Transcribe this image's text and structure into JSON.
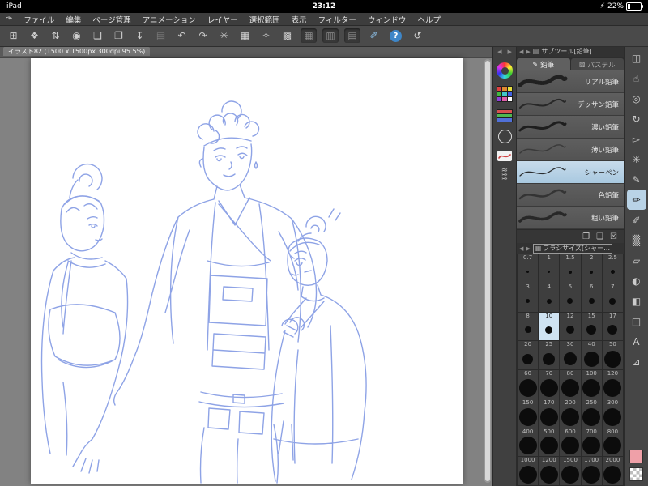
{
  "status_bar": {
    "device": "iPad",
    "time": "23:12",
    "battery_percent": "22%",
    "charging_glyph": "⚡"
  },
  "menu_bar": {
    "logo_glyph": "✑",
    "items": [
      "ファイル",
      "編集",
      "ページ管理",
      "アニメーション",
      "レイヤー",
      "選択範囲",
      "表示",
      "フィルター",
      "ウィンドウ",
      "ヘルプ"
    ]
  },
  "toolbar": {
    "icons": [
      {
        "name": "workspace-grid",
        "glyph": "⊞"
      },
      {
        "name": "select-layer",
        "glyph": "❖"
      },
      {
        "name": "swap-subtool",
        "glyph": "⇅"
      },
      {
        "name": "clip-studio-launch",
        "glyph": "◉"
      },
      {
        "name": "new-file",
        "glyph": "❏"
      },
      {
        "name": "open-file",
        "glyph": "❐"
      },
      {
        "name": "save-file",
        "glyph": "↧"
      },
      {
        "name": "export-file",
        "glyph": "▤",
        "variant": "disabled"
      },
      {
        "name": "undo",
        "glyph": "↶"
      },
      {
        "name": "redo",
        "glyph": "↷"
      },
      {
        "name": "snap-ruler",
        "glyph": "✳"
      },
      {
        "name": "snap-special-ruler",
        "glyph": "▦"
      },
      {
        "name": "snap-grid",
        "glyph": "✧"
      },
      {
        "name": "transform",
        "glyph": "▩"
      },
      {
        "name": "view-toggle-1",
        "glyph": "▦",
        "variant": "pressed"
      },
      {
        "name": "view-toggle-2",
        "glyph": "▥",
        "variant": "pressed"
      },
      {
        "name": "view-toggle-3",
        "glyph": "▤",
        "variant": "pressed"
      },
      {
        "name": "touch-gesture",
        "glyph": "✐",
        "variant": "accent"
      },
      {
        "name": "help",
        "glyph": "?",
        "variant": "help"
      },
      {
        "name": "reset-view",
        "glyph": "↺"
      }
    ]
  },
  "document": {
    "tab_title": "イラスト82 (1500 x 1500px 300dpi 95.5%)"
  },
  "panel_nav": {
    "prev": "◀",
    "next": "▶"
  },
  "tool_column": {
    "color_set_swatches": [
      "#e04040",
      "#e08a30",
      "#e8e040",
      "#40b840",
      "#40c8c8",
      "#4060e0",
      "#9040d8",
      "#e060a8",
      "#ffffff"
    ],
    "slider_colors": [
      "#d85050",
      "#50b850",
      "#5070d8"
    ],
    "texture_glyph": "≈"
  },
  "subtool_panel": {
    "title": "サブツール[鉛筆]",
    "header_icon_glyph": "▤",
    "tabs": [
      {
        "label": "鉛筆",
        "icon": "✎",
        "selected": true
      },
      {
        "label": "パステル",
        "icon": "▨",
        "selected": false
      }
    ],
    "brushes": [
      {
        "label": "リアル鉛筆",
        "stroke_width": 5,
        "stroke_opacity": 0.9,
        "dash": "1 2"
      },
      {
        "label": "デッサン鉛筆",
        "stroke_width": 2,
        "stroke_opacity": 0.8,
        "dash": ""
      },
      {
        "label": "濃い鉛筆",
        "stroke_width": 3,
        "stroke_opacity": 0.95,
        "dash": ""
      },
      {
        "label": "薄い鉛筆",
        "stroke_width": 1.5,
        "stroke_opacity": 0.5,
        "dash": ""
      },
      {
        "label": "シャーペン",
        "stroke_width": 1.3,
        "stroke_opacity": 0.9,
        "dash": ""
      },
      {
        "label": "色鉛筆",
        "stroke_width": 2.5,
        "stroke_opacity": 0.6,
        "dash": ""
      },
      {
        "label": "粗い鉛筆",
        "stroke_width": 3.5,
        "stroke_opacity": 0.8,
        "dash": "2 2"
      }
    ],
    "selected_brush": "シャーペン",
    "actions": [
      {
        "name": "copy-subtool",
        "glyph": "❐"
      },
      {
        "name": "new-subtool",
        "glyph": "❏"
      },
      {
        "name": "delete-subtool",
        "glyph": "☒"
      }
    ]
  },
  "brush_size_panel": {
    "title": "ブラシサイズ[シャー…",
    "header_icon_glyph": "▦",
    "sizes": [
      "0.7",
      "1",
      "1.5",
      "2",
      "2.5",
      "3",
      "4",
      "5",
      "6",
      "7",
      "8",
      "10",
      "12",
      "15",
      "17",
      "20",
      "25",
      "30",
      "40",
      "50",
      "60",
      "70",
      "80",
      "100",
      "120",
      "150",
      "170",
      "200",
      "250",
      "300",
      "400",
      "500",
      "600",
      "700",
      "800",
      "1000",
      "1200",
      "1500",
      "1700",
      "2000"
    ],
    "selected_size": "10"
  },
  "right_strip": {
    "icons": [
      {
        "name": "panel-toggle",
        "glyph": "◫"
      },
      {
        "name": "hand-tool",
        "glyph": "☝"
      },
      {
        "name": "zoom-tool",
        "glyph": "◎"
      },
      {
        "name": "rotate-canvas-tool",
        "glyph": "↻"
      },
      {
        "name": "select-tool",
        "glyph": "▻"
      },
      {
        "name": "wand-tool",
        "glyph": "✳"
      },
      {
        "name": "pen-tool",
        "glyph": "✎"
      },
      {
        "name": "pencil-tool",
        "glyph": "✏",
        "selected": true
      },
      {
        "name": "brush-tool",
        "glyph": "✐"
      },
      {
        "name": "airbrush-tool",
        "glyph": "▒"
      },
      {
        "name": "eraser-tool",
        "glyph": "▱"
      },
      {
        "name": "blend-tool",
        "glyph": "◐"
      },
      {
        "name": "fill-tool",
        "glyph": "◧"
      },
      {
        "name": "figure-tool",
        "glyph": "□"
      },
      {
        "name": "text-tool",
        "glyph": "A"
      },
      {
        "name": "ruler-tool",
        "glyph": "⊿"
      }
    ],
    "sub_color": "#efa0a8"
  },
  "colors": {
    "selection_highlight": "#b9d3e6",
    "sketch_line": "#8ea3e6",
    "canvas_bg": "#828282"
  }
}
